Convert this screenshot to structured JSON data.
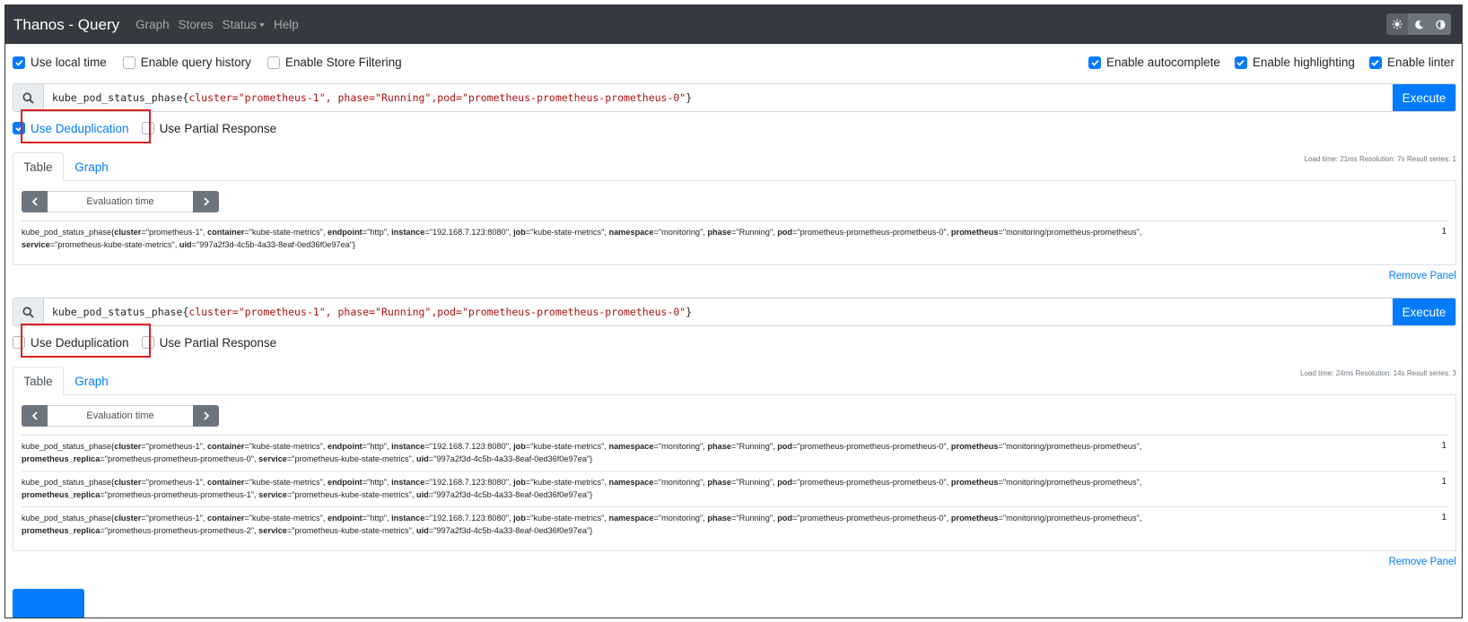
{
  "navbar": {
    "brand": "Thanos - Query",
    "links": [
      "Graph",
      "Stores",
      "Status",
      "Help"
    ]
  },
  "options": {
    "left": [
      {
        "label": "Use local time",
        "checked": true
      },
      {
        "label": "Enable query history",
        "checked": false
      },
      {
        "label": "Enable Store Filtering",
        "checked": false
      }
    ],
    "right": [
      {
        "label": "Enable autocomplete",
        "checked": true
      },
      {
        "label": "Enable highlighting",
        "checked": true
      },
      {
        "label": "Enable linter",
        "checked": true
      }
    ]
  },
  "panels": [
    {
      "query_prefix": "kube_pod_status_phase{",
      "query_parts": [
        "cluster=",
        "\"prometheus-1\"",
        ", phase=",
        "\"Running\"",
        ",pod=",
        "\"prometheus-prometheus-prometheus-0\"",
        "}"
      ],
      "execute_label": "Execute",
      "dedup_label": "Use Deduplication",
      "dedup_checked": true,
      "partial_label": "Use Partial Response",
      "stats": "Load time: 21ms   Resolution: 7s   Result series: 1",
      "tab_table": "Table",
      "tab_graph": "Graph",
      "eval_label": "Evaluation time",
      "results": [
        {
          "line1": [
            {
              "t": "kube_pod_status_phase{"
            },
            {
              "b": "cluster"
            },
            {
              "t": "=\"prometheus-1\", "
            },
            {
              "b": "container"
            },
            {
              "t": "=\"kube-state-metrics\", "
            },
            {
              "b": "endpoint"
            },
            {
              "t": "=\"http\", "
            },
            {
              "b": "instance"
            },
            {
              "t": "=\"192.168.7.123:8080\", "
            },
            {
              "b": "job"
            },
            {
              "t": "=\"kube-state-metrics\", "
            },
            {
              "b": "namespace"
            },
            {
              "t": "=\"monitoring\", "
            },
            {
              "b": "phase"
            },
            {
              "t": "=\"Running\", "
            },
            {
              "b": "pod"
            },
            {
              "t": "=\"prometheus-prometheus-prometheus-0\", "
            },
            {
              "b": "prometheus"
            },
            {
              "t": "=\"monitoring/prometheus-prometheus\","
            }
          ],
          "line2": [
            {
              "b": "service"
            },
            {
              "t": "=\"prometheus-kube-state-metrics\", "
            },
            {
              "b": "uid"
            },
            {
              "t": "=\"997a2f3d-4c5b-4a33-8eaf-0ed36f0e97ea\"}"
            }
          ],
          "value": "1"
        }
      ],
      "remove_label": "Remove Panel"
    },
    {
      "query_prefix": "kube_pod_status_phase{",
      "query_parts": [
        "cluster=",
        "\"prometheus-1\"",
        ", phase=",
        "\"Running\"",
        ",pod=",
        "\"prometheus-prometheus-prometheus-0\"",
        "}"
      ],
      "execute_label": "Execute",
      "dedup_label": "Use Deduplication",
      "dedup_checked": false,
      "partial_label": "Use Partial Response",
      "stats": "Load time: 24ms   Resolution: 14s   Result series: 3",
      "tab_table": "Table",
      "tab_graph": "Graph",
      "eval_label": "Evaluation time",
      "results": [
        {
          "line1": [
            {
              "t": "kube_pod_status_phase{"
            },
            {
              "b": "cluster"
            },
            {
              "t": "=\"prometheus-1\", "
            },
            {
              "b": "container"
            },
            {
              "t": "=\"kube-state-metrics\", "
            },
            {
              "b": "endpoint"
            },
            {
              "t": "=\"http\", "
            },
            {
              "b": "instance"
            },
            {
              "t": "=\"192.168.7.123:8080\", "
            },
            {
              "b": "job"
            },
            {
              "t": "=\"kube-state-metrics\", "
            },
            {
              "b": "namespace"
            },
            {
              "t": "=\"monitoring\", "
            },
            {
              "b": "phase"
            },
            {
              "t": "=\"Running\", "
            },
            {
              "b": "pod"
            },
            {
              "t": "=\"prometheus-prometheus-prometheus-0\", "
            },
            {
              "b": "prometheus"
            },
            {
              "t": "=\"monitoring/prometheus-prometheus\","
            }
          ],
          "line2": [
            {
              "b": "prometheus_replica"
            },
            {
              "t": "=\"prometheus-prometheus-prometheus-0\", "
            },
            {
              "b": "service"
            },
            {
              "t": "=\"prometheus-kube-state-metrics\", "
            },
            {
              "b": "uid"
            },
            {
              "t": "=\"997a2f3d-4c5b-4a33-8eaf-0ed36f0e97ea\"}"
            }
          ],
          "value": "1"
        },
        {
          "line1": [
            {
              "t": "kube_pod_status_phase{"
            },
            {
              "b": "cluster"
            },
            {
              "t": "=\"prometheus-1\", "
            },
            {
              "b": "container"
            },
            {
              "t": "=\"kube-state-metrics\", "
            },
            {
              "b": "endpoint"
            },
            {
              "t": "=\"http\", "
            },
            {
              "b": "instance"
            },
            {
              "t": "=\"192.168.7.123:8080\", "
            },
            {
              "b": "job"
            },
            {
              "t": "=\"kube-state-metrics\", "
            },
            {
              "b": "namespace"
            },
            {
              "t": "=\"monitoring\", "
            },
            {
              "b": "phase"
            },
            {
              "t": "=\"Running\", "
            },
            {
              "b": "pod"
            },
            {
              "t": "=\"prometheus-prometheus-prometheus-0\", "
            },
            {
              "b": "prometheus"
            },
            {
              "t": "=\"monitoring/prometheus-prometheus\","
            }
          ],
          "line2": [
            {
              "b": "prometheus_replica"
            },
            {
              "t": "=\"prometheus-prometheus-prometheus-1\", "
            },
            {
              "b": "service"
            },
            {
              "t": "=\"prometheus-kube-state-metrics\", "
            },
            {
              "b": "uid"
            },
            {
              "t": "=\"997a2f3d-4c5b-4a33-8eaf-0ed36f0e97ea\"}"
            }
          ],
          "value": "1"
        },
        {
          "line1": [
            {
              "t": "kube_pod_status_phase{"
            },
            {
              "b": "cluster"
            },
            {
              "t": "=\"prometheus-1\", "
            },
            {
              "b": "container"
            },
            {
              "t": "=\"kube-state-metrics\", "
            },
            {
              "b": "endpoint"
            },
            {
              "t": "=\"http\", "
            },
            {
              "b": "instance"
            },
            {
              "t": "=\"192.168.7.123:8080\", "
            },
            {
              "b": "job"
            },
            {
              "t": "=\"kube-state-metrics\", "
            },
            {
              "b": "namespace"
            },
            {
              "t": "=\"monitoring\", "
            },
            {
              "b": "phase"
            },
            {
              "t": "=\"Running\", "
            },
            {
              "b": "pod"
            },
            {
              "t": "=\"prometheus-prometheus-prometheus-0\", "
            },
            {
              "b": "prometheus"
            },
            {
              "t": "=\"monitoring/prometheus-prometheus\","
            }
          ],
          "line2": [
            {
              "b": "prometheus_replica"
            },
            {
              "t": "=\"prometheus-prometheus-prometheus-2\", "
            },
            {
              "b": "service"
            },
            {
              "t": "=\"prometheus-kube-state-metrics\", "
            },
            {
              "b": "uid"
            },
            {
              "t": "=\"997a2f3d-4c5b-4a33-8eaf-0ed36f0e97ea\"}"
            }
          ],
          "value": "1"
        }
      ],
      "remove_label": "Remove Panel"
    }
  ],
  "colors": {
    "navbar": "#343a40",
    "accent": "#007bff",
    "highlight_box": "#e02020",
    "query_string": "#aa1111"
  },
  "icons": [
    "search-icon",
    "sun-icon",
    "moon-icon",
    "contrast-icon",
    "chevron-left-icon",
    "chevron-right-icon",
    "check-icon",
    "caret-down-icon"
  ]
}
